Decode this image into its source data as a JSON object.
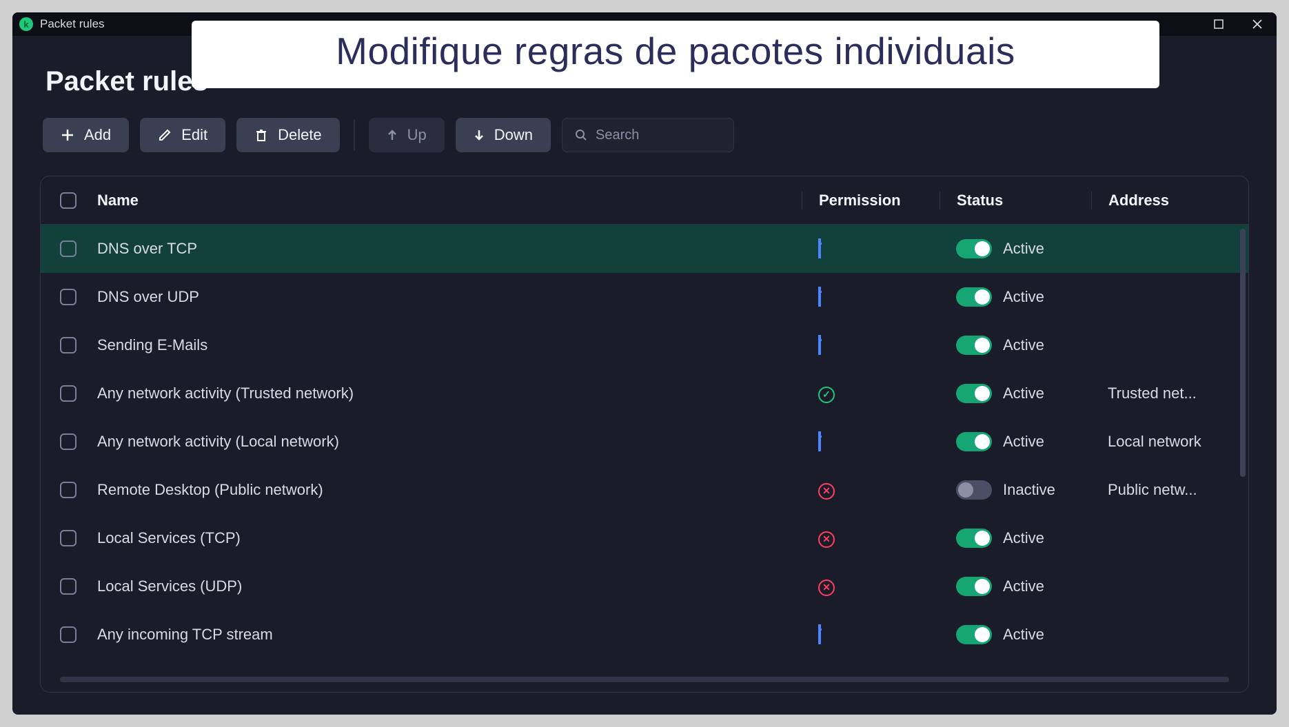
{
  "titlebar": {
    "title": "Packet rules"
  },
  "banner": "Modifique regras de pacotes individuais",
  "heading": "Packet rules",
  "toolbar": {
    "add": "Add",
    "edit": "Edit",
    "delete": "Delete",
    "up": "Up",
    "down": "Down",
    "search_placeholder": "Search"
  },
  "columns": {
    "name": "Name",
    "permission": "Permission",
    "status": "Status",
    "address": "Address"
  },
  "status_labels": {
    "active": "Active",
    "inactive": "Inactive"
  },
  "rows": [
    {
      "name": "DNS over TCP",
      "perm": "window",
      "active": true,
      "address": "",
      "selected": true
    },
    {
      "name": "DNS over UDP",
      "perm": "window",
      "active": true,
      "address": "",
      "selected": false
    },
    {
      "name": "Sending E-Mails",
      "perm": "window",
      "active": true,
      "address": "",
      "selected": false
    },
    {
      "name": "Any network activity (Trusted network)",
      "perm": "check",
      "active": true,
      "address": "Trusted net...",
      "selected": false
    },
    {
      "name": "Any network activity (Local network)",
      "perm": "window",
      "active": true,
      "address": "Local network",
      "selected": false
    },
    {
      "name": "Remote Desktop (Public network)",
      "perm": "deny",
      "active": false,
      "address": "Public netw...",
      "selected": false
    },
    {
      "name": "Local Services (TCP)",
      "perm": "deny",
      "active": true,
      "address": "",
      "selected": false
    },
    {
      "name": "Local Services (UDP)",
      "perm": "deny",
      "active": true,
      "address": "",
      "selected": false
    },
    {
      "name": "Any incoming TCP stream",
      "perm": "window",
      "active": true,
      "address": "",
      "selected": false
    }
  ]
}
